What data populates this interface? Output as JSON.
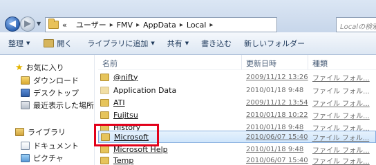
{
  "address": {
    "path": [
      "«",
      "ユーザー",
      "FMV",
      "AppData",
      "Local"
    ],
    "search_placeholder": "Localの検索"
  },
  "toolbar": {
    "organize": "整理",
    "open": "開く",
    "include_library": "ライブラリに追加",
    "share": "共有",
    "burn": "書き込む",
    "new_folder": "新しいフォルダー"
  },
  "sidebar": {
    "favorites": "お気に入り",
    "downloads": "ダウンロード",
    "desktop": "デスクトップ",
    "recent": "最近表示した場所",
    "libraries": "ライブラリ",
    "documents": "ドキュメント",
    "pictures": "ピクチャ"
  },
  "columns": {
    "name": "名前",
    "date": "更新日時",
    "type": "種類"
  },
  "files": [
    {
      "name": "@nifty",
      "date": "2009/11/12 13:26",
      "type": "ファイル フォル..."
    },
    {
      "name": "Application Data",
      "date": "2010/01/18 9:48",
      "type": "ファイル フォル..."
    },
    {
      "name": "ATI",
      "date": "2009/11/12 13:54",
      "type": "ファイル フォル..."
    },
    {
      "name": "Fujitsu",
      "date": "2010/01/18 10:22",
      "type": "ファイル フォル..."
    },
    {
      "name": "History",
      "date": "2010/01/18 9:48",
      "type": "ファイル フォル..."
    },
    {
      "name": "Microsoft",
      "date": "2010/06/07 15:40",
      "type": "ファイル フォル..."
    },
    {
      "name": "Microsoft Help",
      "date": "2010/01/18 9:48",
      "type": "ファイル フォル..."
    },
    {
      "name": "Temp",
      "date": "2010/06/07 15:40",
      "type": "ファイル フォル..."
    }
  ],
  "highlight_color": "#e2001a",
  "selection_color": "#cfe5fb"
}
